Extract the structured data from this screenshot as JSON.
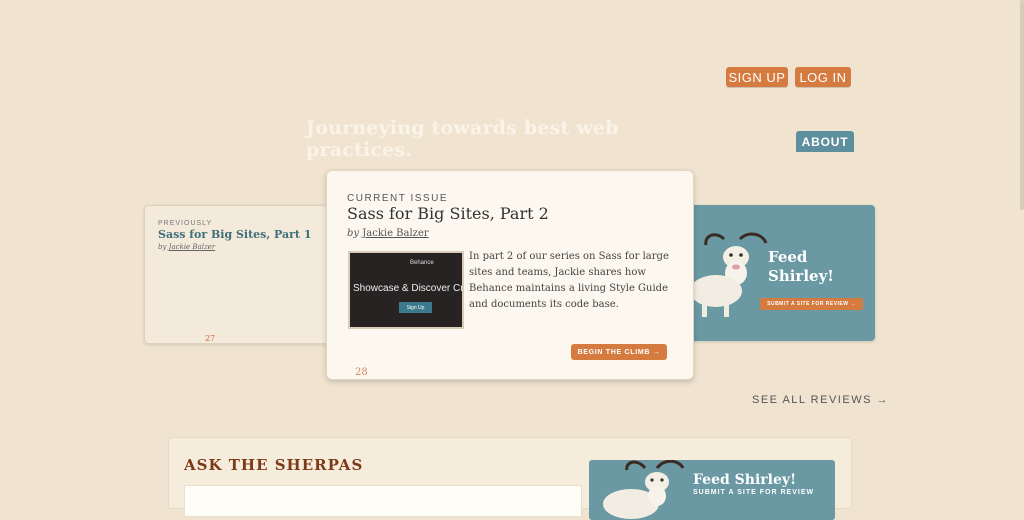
{
  "header": {
    "signup_label": "SIGN UP",
    "login_label": "LOG IN",
    "tagline": "Journeying towards best web practices.",
    "about_label": "ABOUT"
  },
  "previous_issue": {
    "kicker": "PREVIOUSLY",
    "title": "Sass for Big Sites, Part 1",
    "by": "by",
    "author": "Jackie Balzer",
    "number": "27"
  },
  "current_issue": {
    "kicker": "CURRENT ISSUE",
    "title": "Sass for Big Sites, Part 2",
    "by": "by",
    "author": "Jackie Balzer",
    "thumbnail": {
      "brand": "Behance",
      "headline": "Showcase & Discover Crea",
      "button": "Sign Up"
    },
    "description": "In part 2 of our series on Sass for large sites and teams, Jackie shares how Behance maintains a living Style Guide and documents its code base.",
    "cta_label": "BEGIN THE CLIMB →",
    "number": "28"
  },
  "promo": {
    "title": "Feed Shirley!",
    "button_label": "SUBMIT A SITE FOR REVIEW →"
  },
  "see_all_label": "SEE ALL REVIEWS →",
  "sherpas": {
    "title": "ASK THE SHERPAS"
  },
  "promo_bottom": {
    "title": "Feed Shirley!",
    "subtitle": "SUBMIT A SITE FOR REVIEW"
  },
  "colors": {
    "background": "#f0e4d0",
    "accent_orange": "#d57b3f",
    "accent_teal": "#6a99a4",
    "sherpa_brown": "#7d3a18"
  }
}
